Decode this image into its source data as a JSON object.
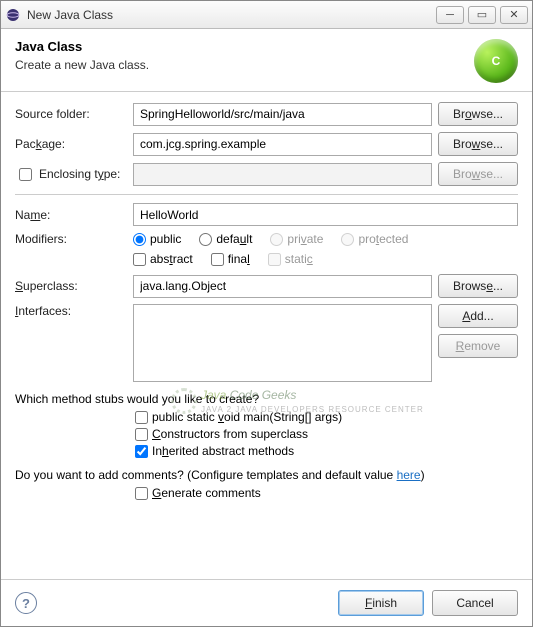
{
  "window": {
    "title": "New Java Class"
  },
  "header": {
    "title": "Java Class",
    "desc": "Create a new Java class.",
    "iconLetter": "C"
  },
  "labels": {
    "sourceFolder": "Source folder:",
    "package": "Package:",
    "enclosingType": "Enclosing type:",
    "name": "Name:",
    "modifiers": "Modifiers:",
    "superclass": "Superclass:",
    "interfaces": "Interfaces:"
  },
  "fields": {
    "sourceFolder": "SpringHelloworld/src/main/java",
    "package": "com.jcg.spring.example",
    "enclosingType": "",
    "name": "HelloWorld",
    "superclass": "java.lang.Object"
  },
  "buttons": {
    "browse": "Browse...",
    "add": "Add...",
    "remove": "Remove",
    "finish": "Finish",
    "cancel": "Cancel"
  },
  "modifiers": {
    "public": "public",
    "default": "default",
    "private": "private",
    "protected": "protected",
    "abstract": "abstract",
    "final": "final",
    "static": "static"
  },
  "stubs": {
    "question": "Which method stubs would you like to create?",
    "main": "public static void main(String[] args)",
    "constructors": "Constructors from superclass",
    "inherited": "Inherited abstract methods"
  },
  "comments": {
    "question_a": "Do you want to add comments? (Configure templates and default value ",
    "here": "here",
    "question_b": ")",
    "generate": "Generate comments"
  },
  "watermark": {
    "text1": "Java ",
    "text2": "Code Geeks",
    "sub": "JAVA 2 JAVA DEVELOPERS RESOURCE CENTER"
  }
}
